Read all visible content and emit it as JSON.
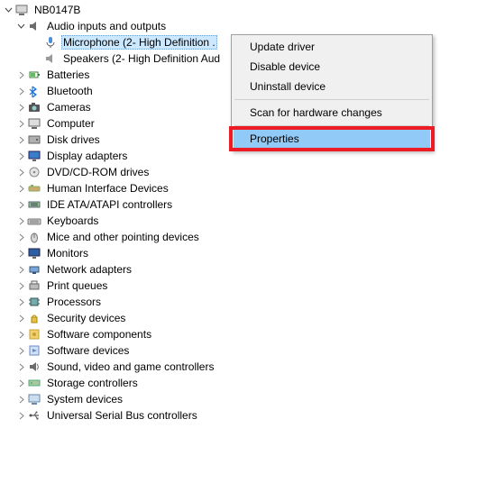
{
  "root": {
    "label": "NB0147B"
  },
  "audio": {
    "label": "Audio inputs and outputs",
    "microphone": "Microphone (2- High Definition .",
    "speakers": "Speakers (2- High Definition Aud"
  },
  "categories": [
    "Batteries",
    "Bluetooth",
    "Cameras",
    "Computer",
    "Disk drives",
    "Display adapters",
    "DVD/CD-ROM drives",
    "Human Interface Devices",
    "IDE ATA/ATAPI controllers",
    "Keyboards",
    "Mice and other pointing devices",
    "Monitors",
    "Network adapters",
    "Print queues",
    "Processors",
    "Security devices",
    "Software components",
    "Software devices",
    "Sound, video and game controllers",
    "Storage controllers",
    "System devices",
    "Universal Serial Bus controllers"
  ],
  "context_menu": {
    "update": "Update driver",
    "disable": "Disable device",
    "uninstall": "Uninstall device",
    "scan": "Scan for hardware changes",
    "properties": "Properties"
  }
}
